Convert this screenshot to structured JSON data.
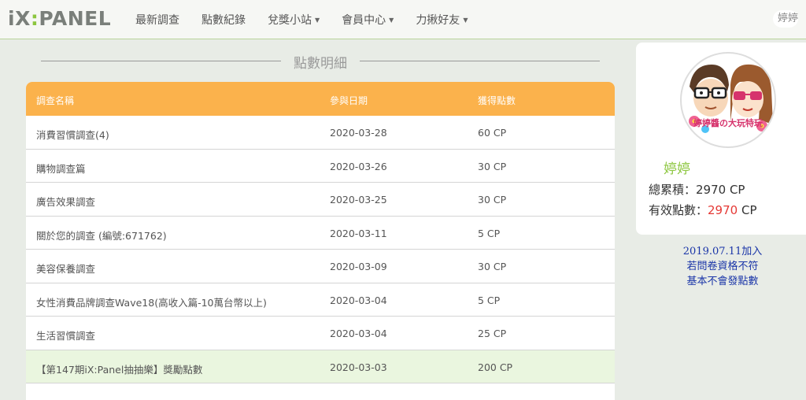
{
  "brand": {
    "prefix": "iX",
    "colon": ":",
    "suffix": "PANEL"
  },
  "nav": [
    {
      "label": "最新調查",
      "dropdown": false
    },
    {
      "label": "點數紀錄",
      "dropdown": false
    },
    {
      "label": "兌獎小站",
      "dropdown": true
    },
    {
      "label": "會員中心",
      "dropdown": true
    },
    {
      "label": "力揪好友",
      "dropdown": true
    }
  ],
  "user": {
    "name": "婷婷"
  },
  "section": {
    "title": "點數明細"
  },
  "table": {
    "headers": [
      "調查名稱",
      "參與日期",
      "獲得點數"
    ],
    "rows": [
      {
        "name": "消費習慣調查(4)",
        "date": "2020-03-28",
        "points": "60 CP"
      },
      {
        "name": "購物調查篇",
        "date": "2020-03-26",
        "points": "30 CP"
      },
      {
        "name": "廣告效果調查",
        "date": "2020-03-25",
        "points": "30 CP"
      },
      {
        "name": "關於您的調查 (編號:671762)",
        "date": "2020-03-11",
        "points": "5 CP"
      },
      {
        "name": "美容保養調查",
        "date": "2020-03-09",
        "points": "30 CP"
      },
      {
        "name": "女性消費品牌調查Wave18(高收入篇-10萬台幣以上)",
        "date": "2020-03-04",
        "points": "5 CP"
      },
      {
        "name": "生活習慣調查",
        "date": "2020-03-04",
        "points": "25 CP"
      },
      {
        "name": "【第147期iX:Panel抽抽樂】獎勵點數",
        "date": "2020-03-03",
        "points": "200 CP"
      }
    ]
  },
  "profile": {
    "name": "婷婷",
    "total_label": "總累積：",
    "total_value": "2970 CP",
    "valid_label": "有效點數：",
    "valid_value": "2970",
    "valid_unit": " CP",
    "avatar_text": "婷婷醬の大玩特玩"
  },
  "note": {
    "line1": "2019.07.11加入",
    "line2": "若問卷資格不符",
    "line3": "基本不會發點數"
  },
  "colors": {
    "accent_green": "#8cc63e",
    "table_header": "#fbb24c",
    "highlight_row": "#eaf6df",
    "valid_points": "#e53935",
    "note_text": "#1a35a8"
  }
}
